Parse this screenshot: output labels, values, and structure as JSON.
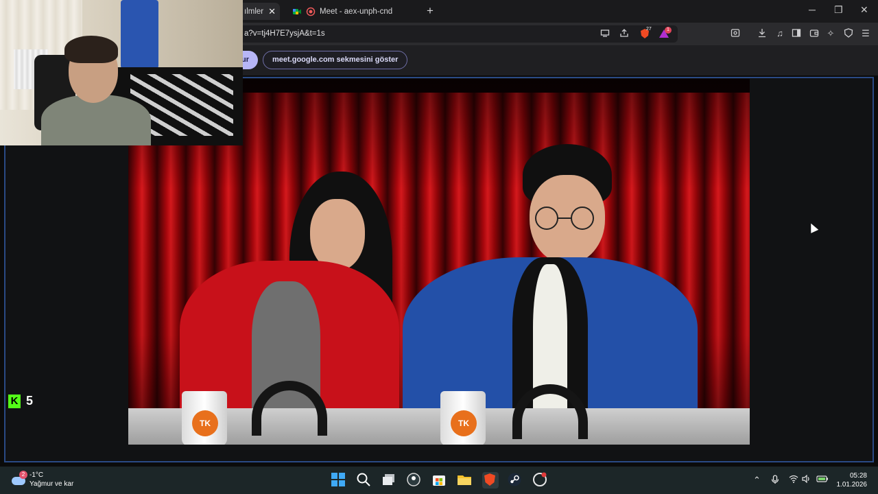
{
  "browser": {
    "tabs": [
      {
        "label": "ılmler",
        "active": true
      },
      {
        "label": "Meet - aex-unph-cnd",
        "active": false
      }
    ],
    "new_tab_glyph": "+",
    "close_glyph": "✕",
    "url": "a?v=tj4H7E7ysjA&t=1s",
    "shield_count": "27",
    "alert_count": "1",
    "window_controls": {
      "minimize": "─",
      "restore": "❐",
      "close": "✕"
    }
  },
  "infobar": {
    "left_pill": "ur",
    "button": "meet.google.com sekmesini göster"
  },
  "overlay": {
    "badge_letter": "K",
    "badge_value": "5"
  },
  "video": {
    "mug_logo": "TK"
  },
  "taskbar": {
    "weather": {
      "badge": "2",
      "temp": "-1°C",
      "condition": "Yağmur ve kar"
    },
    "clock": {
      "time": "05:28",
      "date": "1.01.2026"
    }
  },
  "colors": {
    "accent_border": "#2a4a85",
    "pill_bg": "#b7b6f7",
    "kick_green": "#53fc18",
    "brave_orange": "#f04a23"
  }
}
